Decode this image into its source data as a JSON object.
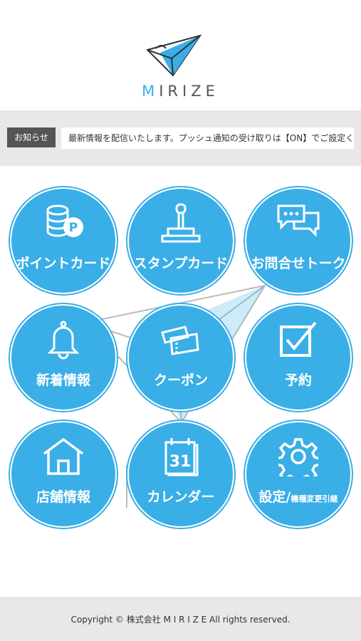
{
  "brand": {
    "name": "MIRIZE",
    "accent": "#3aaee6"
  },
  "notice": {
    "badge": "お知らせ",
    "text": "最新情報を配信いたします。プッシュ通知の受け取りは【ON】でご設定ください。"
  },
  "menu": [
    {
      "label": "ポイントカード",
      "icon": "point-card-icon"
    },
    {
      "label": "スタンプカード",
      "icon": "stamp-icon"
    },
    {
      "label": "お問合せトーク",
      "icon": "chat-bubbles-icon"
    },
    {
      "label": "新着情報",
      "icon": "bell-icon"
    },
    {
      "label": "クーポン",
      "icon": "coupon-icon"
    },
    {
      "label": "予約",
      "icon": "checkbox-icon"
    },
    {
      "label": "店舗情報",
      "icon": "house-icon"
    },
    {
      "label": "カレンダー",
      "icon": "calendar-icon"
    },
    {
      "label": "設定/",
      "sublabel": "機種変更引継",
      "icon": "gear-icon"
    }
  ],
  "calendar_day": "31",
  "point_badge": "P",
  "footer": {
    "copyright": "Copyright © 株式会社 M I R I Z E All rights reserved."
  }
}
